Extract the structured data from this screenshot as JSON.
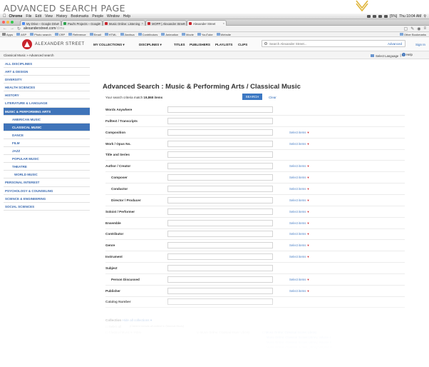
{
  "page_heading": "ADVANCED SEARCH PAGE",
  "os_menubar": {
    "app": "Chrome",
    "items": [
      "File",
      "Edit",
      "View",
      "History",
      "Bookmarks",
      "People",
      "Window",
      "Help"
    ],
    "clock": "Thu 10:04 AM",
    "battery": "[5%]"
  },
  "tabs": [
    {
      "label": "My Drive – Google Drive",
      "color": "#4b8bf4"
    },
    {
      "label": "Paul's Projects – Google",
      "color": "#2da44e"
    },
    {
      "label": "Music Online: Listening",
      "color": "#c8232c"
    },
    {
      "label": "MOPP | Alexander Street",
      "color": "#c8232c"
    },
    {
      "label": "Alexander Street",
      "color": "#c8232c"
    }
  ],
  "address": {
    "url": "alexanderstreet.com",
    "url_path": "/clmu"
  },
  "bookmarks": {
    "items": [
      "Apps",
      "ASP",
      "Photo search",
      "CRP",
      "Reference",
      "Email",
      "HTML",
      "Jianhua",
      "Contributors",
      "Animation",
      "Movie",
      "YouTube",
      "Website"
    ],
    "other": "Other Bookmarks"
  },
  "header": {
    "logo_text": "ALEXANDER STREET",
    "nav": [
      "MY COLLECTIONS ▾",
      "DISCIPLINES ▾",
      "TITLES",
      "PUBLISHERS",
      "PLAYLISTS",
      "CLIPS"
    ],
    "search_placeholder": "Search Alexander Street...",
    "advanced_link": "Advanced",
    "signin": "Sign In"
  },
  "breadcrumb": "Classical Music  »  Advanced search",
  "language": "Select Language",
  "help": "Help",
  "sidebar": [
    {
      "label": "ALL DISCIPLINES",
      "level": 0
    },
    {
      "label": "ART & DESIGN",
      "level": 0
    },
    {
      "label": "DIVERSITY",
      "level": 0
    },
    {
      "label": "HEALTH SCIENCES",
      "level": 0
    },
    {
      "label": "HISTORY",
      "level": 0
    },
    {
      "label": "LITERATURE & LANGUAGE",
      "level": 0
    },
    {
      "label": "MUSIC & PERFORMING ARTS",
      "level": 0,
      "state": "parent"
    },
    {
      "label": "AMERICAN MUSIC",
      "level": 1
    },
    {
      "label": "CLASSICAL MUSIC",
      "level": 1,
      "state": "active"
    },
    {
      "label": "DANCE",
      "level": 1
    },
    {
      "label": "FILM",
      "level": 1
    },
    {
      "label": "JAZZ",
      "level": 1
    },
    {
      "label": "POPULAR MUSIC",
      "level": 1
    },
    {
      "label": "THEATRE",
      "level": 1
    },
    {
      "label": "WORLD MUSIC",
      "level": 2
    },
    {
      "label": "PERSONAL INTEREST",
      "level": 0
    },
    {
      "label": "PSYCHOLOGY & COUNSELING",
      "level": 0
    },
    {
      "label": "SCIENCE & ENGINEERING",
      "level": 0
    },
    {
      "label": "SOCIAL SCIENCES",
      "level": 0
    }
  ],
  "main": {
    "title": "Advanced Search : Music & Performing Arts / Classical Music",
    "criteria_prefix": "Your search criteria match",
    "criteria_count": "19,868",
    "criteria_suffix": "items",
    "search_button": "SEARCH",
    "clear_link": "Clear",
    "select_items_label": "Select items",
    "fields": [
      {
        "label": "Words Anywhere",
        "sub": false,
        "select": false
      },
      {
        "label": "Fulltext / Transcripts",
        "sub": false,
        "select": false
      },
      {
        "label": "Composition",
        "sub": false,
        "select": true
      },
      {
        "label": "Work / Opus No.",
        "sub": false,
        "select": true
      },
      {
        "label": "Title and Series",
        "sub": false,
        "select": false
      },
      {
        "label": "Author / Creator",
        "sub": false,
        "select": true
      },
      {
        "label": "Composer",
        "sub": true,
        "select": true
      },
      {
        "label": "Conductor",
        "sub": true,
        "select": true
      },
      {
        "label": "Director / Producer",
        "sub": true,
        "select": true
      },
      {
        "label": "Soloist / Performer",
        "sub": false,
        "select": true
      },
      {
        "label": "Ensemble",
        "sub": false,
        "select": true
      },
      {
        "label": "Contributor",
        "sub": false,
        "select": true
      },
      {
        "label": "Genre",
        "sub": false,
        "select": true
      },
      {
        "label": "Instrument",
        "sub": false,
        "select": true
      },
      {
        "label": "Subject",
        "sub": false,
        "select": false
      },
      {
        "label": "Person Discussed",
        "sub": true,
        "select": true
      },
      {
        "label": "Publisher",
        "sub": false,
        "select": true
      },
      {
        "label": "Catalog Number",
        "sub": false,
        "select": false
      }
    ]
  },
  "collection": {
    "heading": "Collection",
    "hide_link": "Hide all collections ▾",
    "select_all": "Select all",
    "check_note": "(Check to include all content in Classical Music)",
    "col1": "Classical Music in Video",
    "col2": "Music Online: Classical Music Library",
    "col3_head": "Music Online: Classical Scores Library",
    "col3_items": [
      "Music Online: Classical Scores Library, Volume I",
      "Music Online: Classical Scores Library, Volume II",
      "Music Online: Classical Scores Library, Volume III",
      "Music Online: Classical Scores Library, Volume IV"
    ]
  }
}
